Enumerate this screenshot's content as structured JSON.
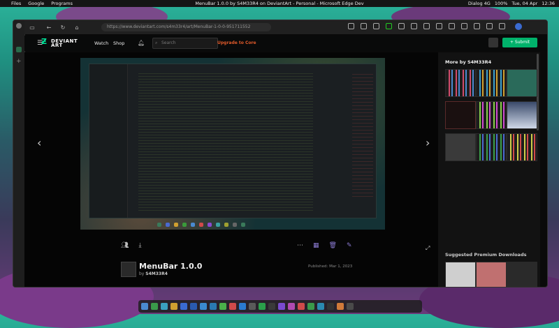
{
  "topbar": {
    "menu": [
      "Files",
      "Google",
      "Programs"
    ],
    "window_title": "MenuBar 1.0.0 by S4M33R4 on DeviantArt - Personal - Microsoft Edge Dev",
    "network": "Dialog 4G",
    "battery": "100%",
    "datetime": "Tue, 04 Apr",
    "time": "12:36"
  },
  "browser": {
    "url": "https://www.deviantart.com/s4m33r4/art/MenuBar-1-0-0-951711552"
  },
  "site": {
    "logo_line1": "DEVIANT",
    "logo_line2": "ART",
    "watch_label": "Watch",
    "shop_label": "Shop",
    "search_placeholder": "Search",
    "core_label": "Upgrade to Core",
    "submit_label": "+ Submit"
  },
  "artwork": {
    "title": "MenuBar 1.0.0",
    "by_prefix": "by",
    "author": "S4M33R4",
    "published": "Published: Mar 1, 2023"
  },
  "rightpanel": {
    "more_by": "More by S4M33R4",
    "suggested": "Suggested Premium Downloads"
  },
  "colors": {
    "accent": "#00b26b",
    "core": "#e05a2a"
  }
}
